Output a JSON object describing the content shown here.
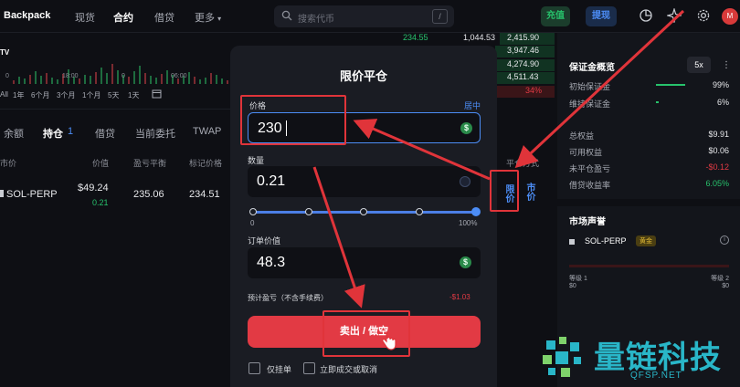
{
  "colors": {
    "accent": "#4c8df6",
    "green": "#27c26c",
    "red": "#e23a44",
    "annotation": "#e0343a",
    "watermark": "#29b6c8"
  },
  "header": {
    "logo": "Backpack",
    "nav": [
      "现货",
      "合约",
      "借贷",
      "更多"
    ],
    "active_nav": "合约",
    "search_placeholder": "搜索代币",
    "search_shortcut": "/",
    "deposit": "充值",
    "withdraw": "提现",
    "icons": [
      "pie-chart-icon",
      "sparkle-icon",
      "gear-icon"
    ],
    "avatar": "M"
  },
  "chart": {
    "x_ticks": [
      "0",
      "18:00",
      "0",
      "06:00"
    ],
    "ranges": [
      "All",
      "1年",
      "6个月",
      "3个月",
      "1个月",
      "5天",
      "1天"
    ],
    "tv_mark": "TV"
  },
  "positions": {
    "tabs": [
      "余额",
      "持仓",
      "借贷",
      "当前委托",
      "TWAP"
    ],
    "active_tab": "持仓",
    "position_count": "1",
    "columns": [
      "市价",
      "价值",
      "盈亏平衡",
      "标记价格"
    ],
    "row": {
      "symbol": "SOL-PERP",
      "value": "$49.24",
      "size": "0.21",
      "breakeven": "235.06",
      "mark": "234.51"
    },
    "close_col": "平仓方式"
  },
  "orderbook": {
    "rows": [
      {
        "price": "234.55",
        "size": "1,044.53",
        "total": "2,415.90"
      },
      {
        "price": "",
        "size": "",
        "total": "3,947.46"
      },
      {
        "price": "",
        "size": "",
        "total": "4,274.90"
      },
      {
        "price": "",
        "size": "",
        "total": "4,511.43"
      },
      {
        "price": "",
        "size": "",
        "total": "34%"
      }
    ]
  },
  "account": {
    "title": "保证金概览",
    "leverage": "5x",
    "rows": [
      {
        "label": "初始保证金",
        "value": "99%"
      },
      {
        "label": "维持保证金",
        "value": "6%"
      },
      {
        "label": "总权益",
        "value": "$9.91"
      },
      {
        "label": "可用权益",
        "value": "$0.06"
      },
      {
        "label": "未平仓盈亏",
        "value": "-$0.12"
      },
      {
        "label": "借贷收益率",
        "value": "6.05%"
      }
    ],
    "voice_title": "市场声誉",
    "voice_symbol": "SOL-PERP",
    "voice_badge": "黄金",
    "level1": "等级 1",
    "level2": "等级 2",
    "level1_val": "$0",
    "level2_val": "$0"
  },
  "modal": {
    "title": "限价平仓",
    "price_label": "价格",
    "mid_label": "居中",
    "price": "230",
    "qty_label": "数量",
    "qty": "0.21",
    "slider_min": "0",
    "slider_max": "100%",
    "slider_fraction": 1.0,
    "value_label": "订单价值",
    "order_value": "48.3",
    "pnl_label": "预计盈亏（不含手续费）",
    "pnl": "-$1.03",
    "sell_button": "卖出 / 做空",
    "post_only": "仅挂单",
    "ioc": "立即成交或取消",
    "coin_icon": "$"
  },
  "close_types": {
    "limit": "限价",
    "market": "市价"
  },
  "watermark": {
    "brand": "量链科技",
    "url": "QFSP.NET"
  }
}
